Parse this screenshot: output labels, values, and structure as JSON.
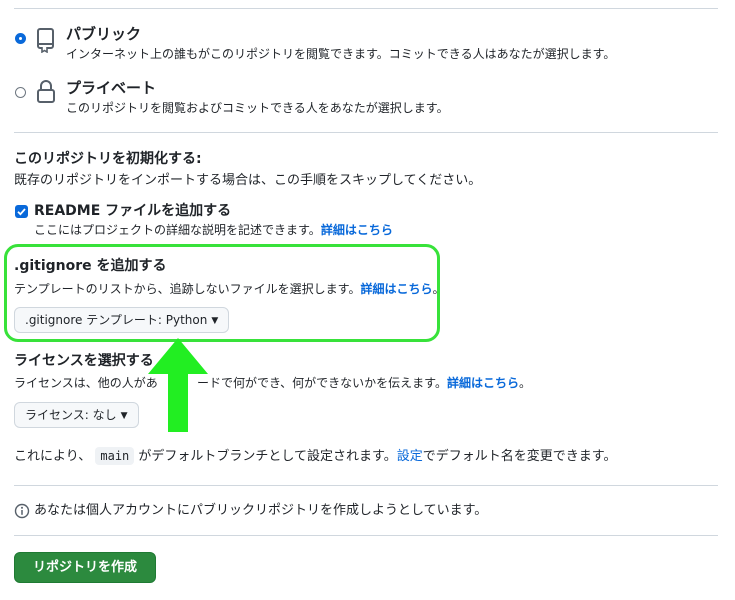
{
  "visibility": {
    "public": {
      "title": "パブリック",
      "description": "インターネット上の誰もがこのリポジトリを閲覧できます。コミットできる人はあなたが選択します。",
      "checked": true,
      "icon": "repo-icon"
    },
    "private": {
      "title": "プライベート",
      "description": "このリポジトリを閲覧およびコミットできる人をあなたが選択します。",
      "checked": false,
      "icon": "lock-icon"
    }
  },
  "initialize": {
    "heading": "このリポジトリを初期化する:",
    "description": "既存のリポジトリをインポートする場合は、この手順をスキップしてください。",
    "readme": {
      "label": "README ファイルを追加する",
      "description": "ここにはプロジェクトの詳細な説明を記述できます。",
      "link": "詳細はこちら",
      "checked": true
    }
  },
  "gitignore": {
    "heading": ".gitignore を追加する",
    "description": "テンプレートのリストから、追跡しないファイルを選択します。",
    "link": "詳細はこちら",
    "period": "。",
    "button_label": ".gitignore テンプレート: Python"
  },
  "license": {
    "heading": "ライセンスを選択する",
    "description_left": "ライセンスは、他の人があ",
    "description_right": "ードで何ができ、何ができないかを伝えます。",
    "link": "詳細はこちら",
    "period": "。",
    "button_label": "ライセンス: なし"
  },
  "branch_note": {
    "prefix": "これにより、",
    "branch": "main",
    "middle": "がデフォルトブランチとして設定されます。",
    "link": "設定",
    "suffix": "でデフォルト名を変更できます。"
  },
  "info_note": "あなたは個人アカウントにパブリックリポジトリを作成しようとしています。",
  "create_button": "リポジトリを作成",
  "colors": {
    "accent": "#0969da",
    "highlight": "#38e23a",
    "create": "#2c8a3e"
  }
}
